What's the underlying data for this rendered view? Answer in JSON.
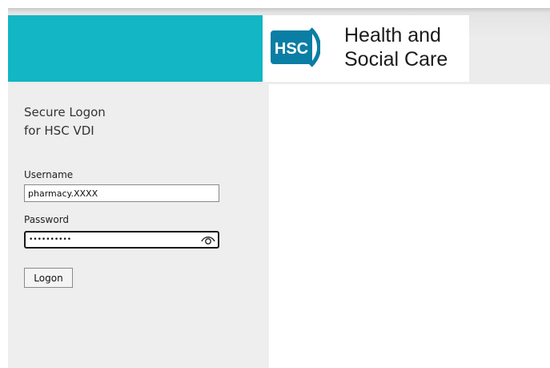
{
  "header": {
    "brand_abbr": "HSC",
    "brand_line1": "Health and",
    "brand_line2": "Social Care",
    "colors": {
      "teal": "#12b6c4",
      "logo_blue": "#0a7ea4"
    }
  },
  "login": {
    "title_line1": "Secure Logon",
    "title_line2": "for HSC VDI",
    "username_label": "Username",
    "username_value": "pharmacy.XXXX",
    "password_label": "Password",
    "password_value": "••••••••••",
    "show_password_icon": "eye-icon",
    "logon_button": "Logon"
  }
}
